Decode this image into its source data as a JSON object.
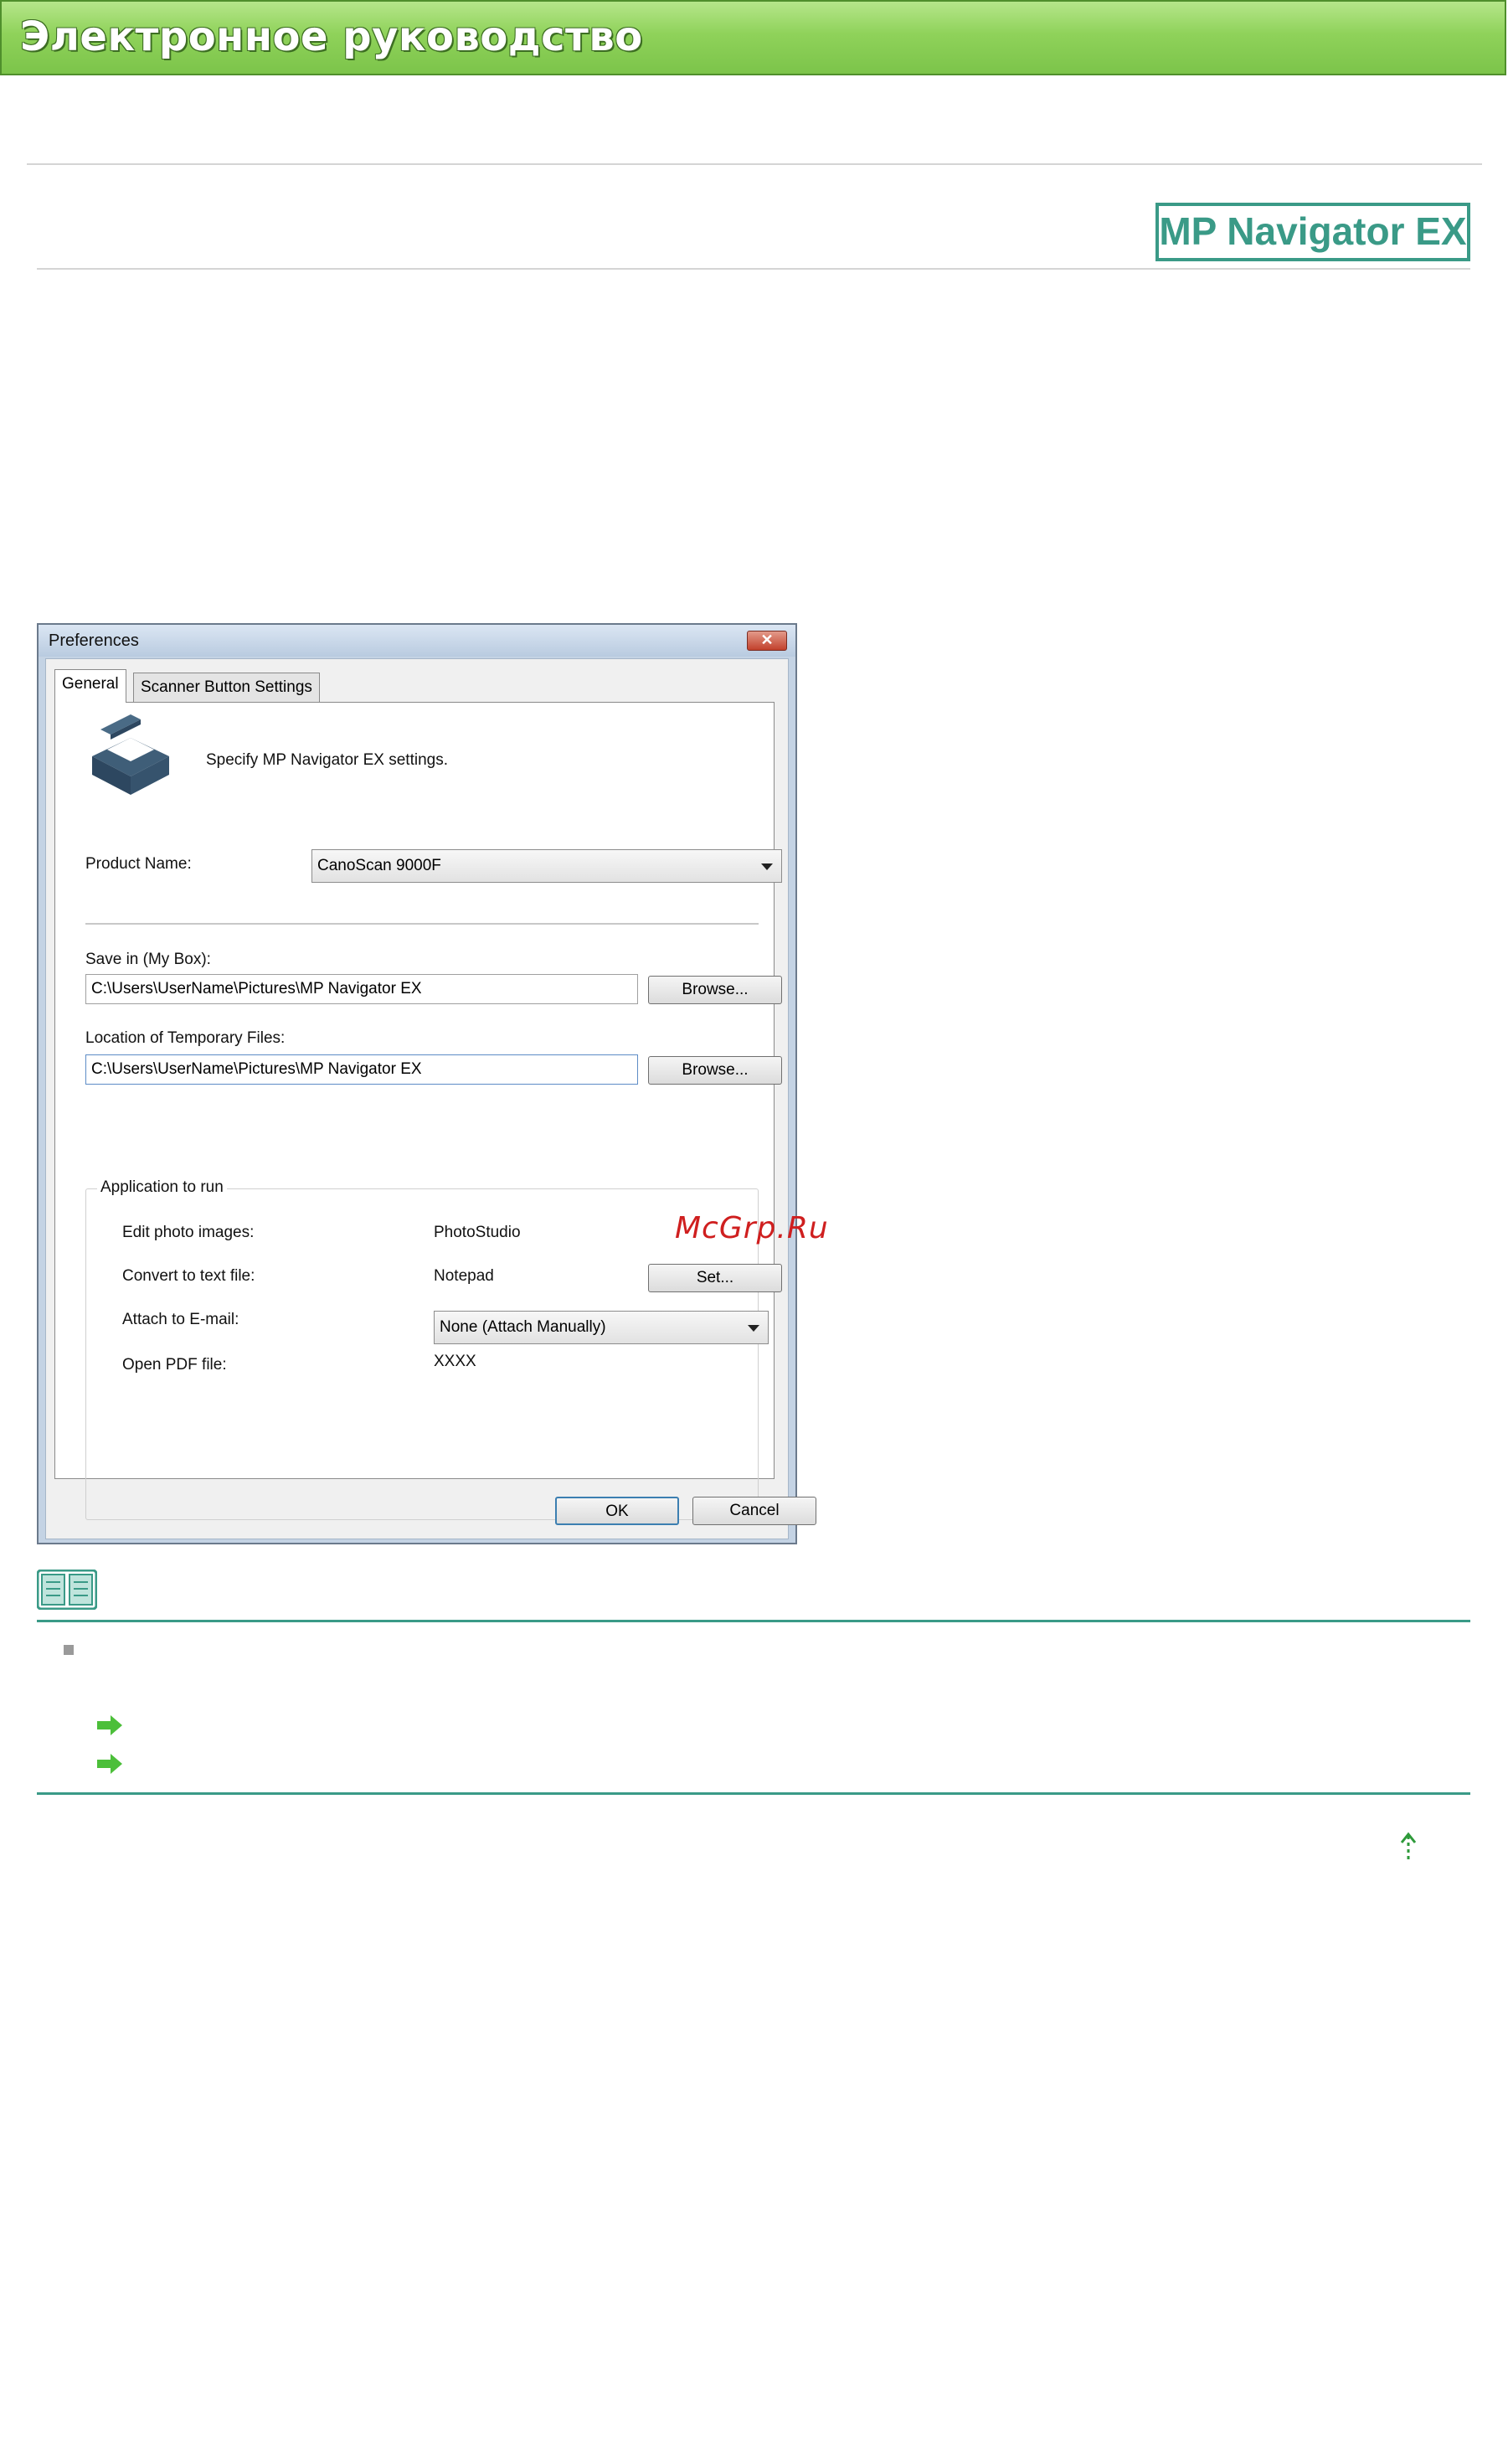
{
  "header": {
    "title": "Электронное руководство"
  },
  "brand": {
    "label": "MP Navigator EX"
  },
  "dialog": {
    "title": "Preferences",
    "close_symbol": "✕",
    "tabs": [
      {
        "label": "General",
        "selected": true
      },
      {
        "label": "Scanner Button Settings",
        "selected": false
      }
    ],
    "intro": "Specify MP Navigator EX settings.",
    "product_name_label": "Product Name:",
    "product_name_value": "CanoScan 9000F",
    "save_in_label": "Save in (My Box):",
    "save_in_value": "C:\\Users\\UserName\\Pictures\\MP Navigator EX",
    "temp_label": "Location of Temporary Files:",
    "temp_value": "C:\\Users\\UserName\\Pictures\\MP Navigator EX",
    "browse_label": "Browse...",
    "app_group": {
      "legend": "Application to run",
      "rows": [
        {
          "label": "Edit photo images:",
          "value": "PhotoStudio"
        },
        {
          "label": "Convert to text file:",
          "value": "Notepad"
        },
        {
          "label": "Attach to E-mail:",
          "value": "None (Attach Manually)"
        },
        {
          "label": "Open PDF file:",
          "value": "XXXX"
        }
      ],
      "set_label": "Set..."
    },
    "ok_label": "OK",
    "cancel_label": "Cancel"
  },
  "watermark": {
    "text": "McGrp.Ru"
  },
  "colors": {
    "banner": "#8fd25a",
    "accent": "#3a9a87",
    "arrow": "#4cbf3a"
  }
}
